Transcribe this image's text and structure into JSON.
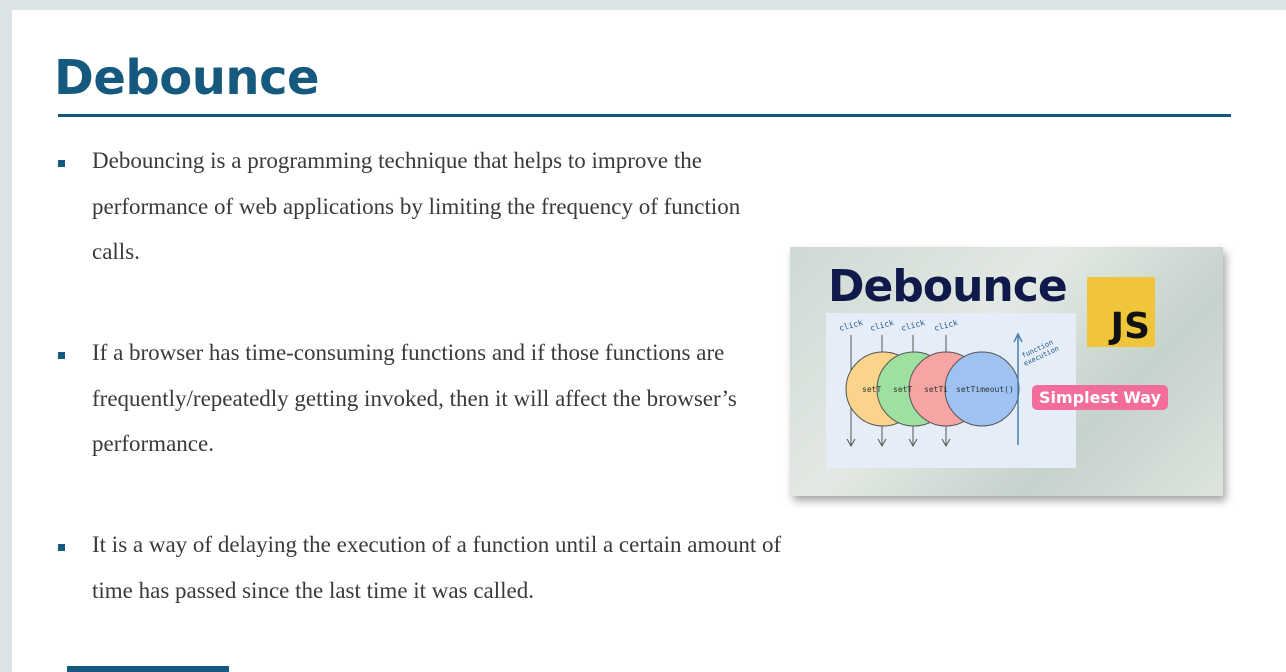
{
  "slide": {
    "title": "Debounce",
    "bullets": [
      "Debouncing is a programming technique that helps to improve the performance of web applications by limiting the frequency of function calls.",
      "If a browser has time-consuming functions and if those functions are frequently/repeatedly getting invoked, then it will affect the browser’s performance.",
      "It is a way of delaying the execution of a function until a certain amount of time has passed since the last time it was called."
    ]
  },
  "thumbnail": {
    "title": "Debounce",
    "badge": "JS",
    "tag": "Simplest Way",
    "diagram": {
      "clicks": [
        "click",
        "click",
        "click",
        "click"
      ],
      "circle_labels": [
        "setT",
        "setT",
        "setTi",
        "setTimeout()"
      ],
      "arrow_label_1": "function",
      "arrow_label_2": "execution"
    }
  },
  "colors": {
    "accent": "#155a7e",
    "js_yellow": "#f0c53a",
    "tag_pink": "#f26d9c"
  }
}
